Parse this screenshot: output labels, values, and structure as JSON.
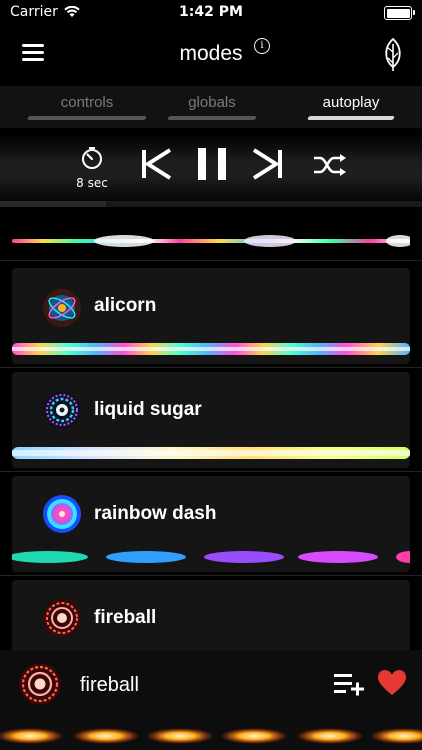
{
  "status_bar": {
    "carrier": "Carrier",
    "time": "1:42 PM"
  },
  "nav": {
    "title": "modes"
  },
  "tabs": [
    {
      "label": "controls",
      "active": false
    },
    {
      "label": "globals",
      "active": false
    },
    {
      "label": "autoplay",
      "active": true
    }
  ],
  "playback": {
    "timer_label": "8 sec",
    "progress": 0.25
  },
  "modes": [
    {
      "name": "alicorn"
    },
    {
      "name": "liquid sugar"
    },
    {
      "name": "rainbow dash"
    },
    {
      "name": "fireball"
    }
  ],
  "now_playing": {
    "name": "fireball",
    "favorited": true
  },
  "colors": {
    "background": "#000000",
    "card": "#151515",
    "heart": "#e53935",
    "active_tab": "#ffffff",
    "inactive_tab": "#7a7a7a"
  }
}
